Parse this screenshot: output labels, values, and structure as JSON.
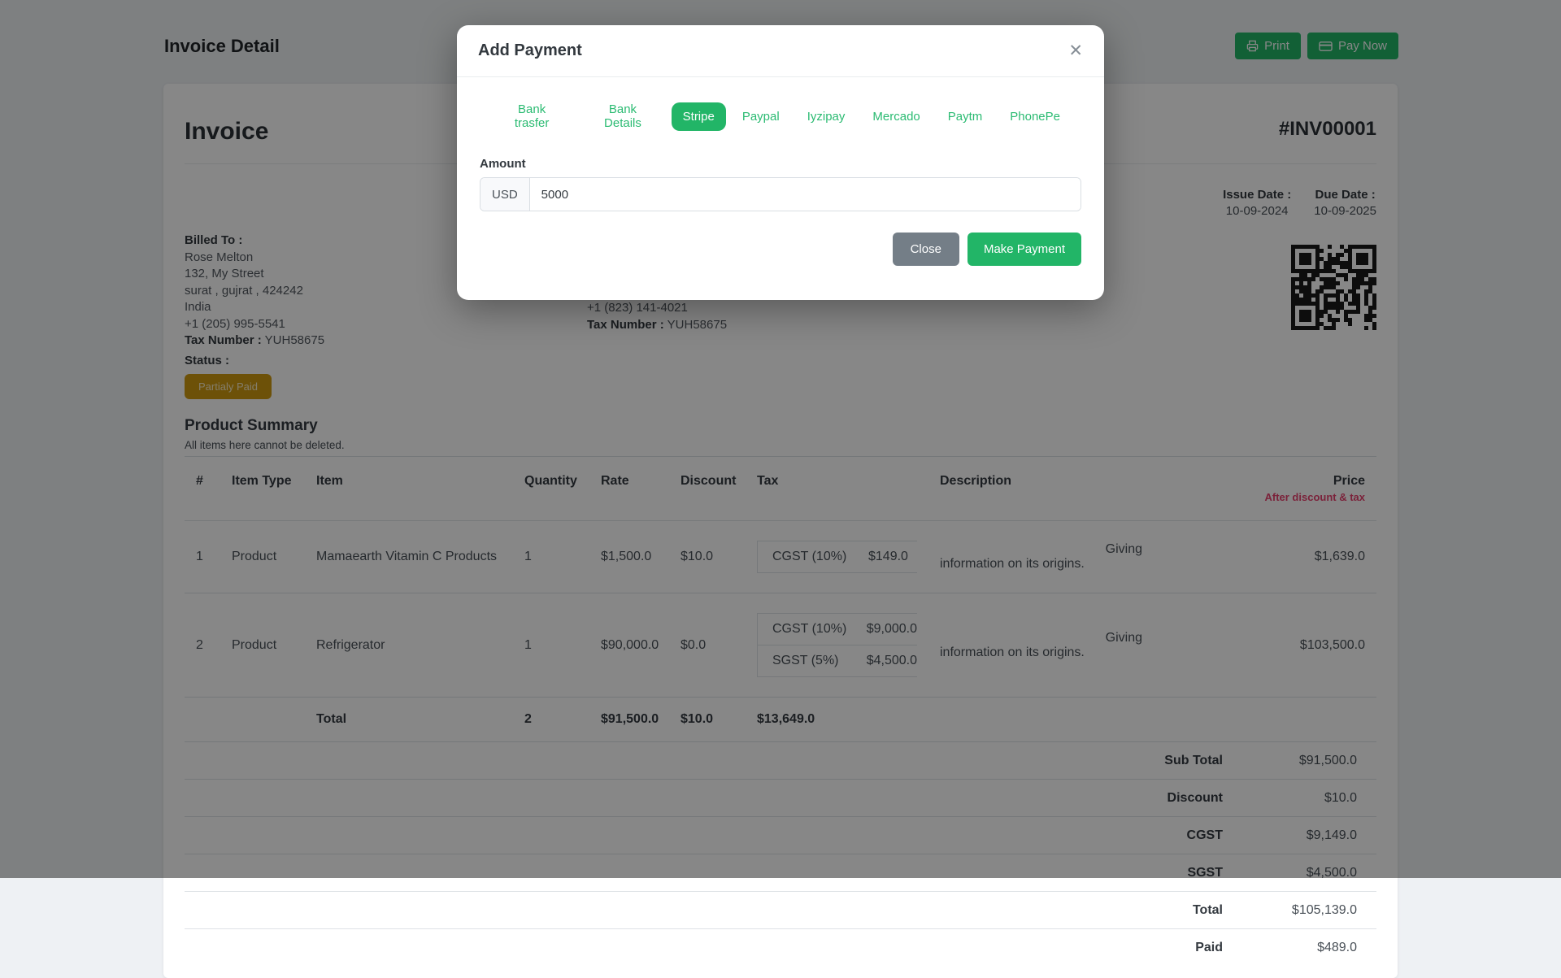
{
  "page": {
    "title": "Invoice Detail",
    "print_label": "Print",
    "pay_now_label": "Pay Now"
  },
  "invoice": {
    "heading": "Invoice",
    "number": "#INV00001",
    "billed_to": {
      "label": "Billed To :",
      "name": "Rose Melton",
      "street": "132, My Street",
      "city": "surat , gujrat , 424242",
      "country": "India",
      "phone": "+1 (205) 995-5541",
      "tax_label": "Tax Number :",
      "tax_value": "YUH58675"
    },
    "shipped_visible": {
      "phone": "+1 (823) 141-4021",
      "tax_label": "Tax Number :",
      "tax_value": "YUH58675"
    },
    "issue_date": {
      "label": "Issue Date :",
      "value": "10-09-2024"
    },
    "due_date": {
      "label": "Due Date :",
      "value": "10-09-2025"
    },
    "status_label": "Status :",
    "status_badge": "Partialy Paid"
  },
  "product_summary": {
    "title": "Product Summary",
    "note": "All items here cannot be deleted.",
    "columns": [
      "#",
      "Item Type",
      "Item",
      "Quantity",
      "Rate",
      "Discount",
      "Tax",
      "Description",
      "Price"
    ],
    "price_subheader": "After discount & tax",
    "rows": [
      {
        "num": "1",
        "item_type": "Product",
        "item": "Mamaearth Vitamin C Products",
        "quantity": "1",
        "rate": "$1,500.0",
        "discount": "$10.0",
        "taxes": [
          {
            "name": "CGST (10%)",
            "amount": "$149.0"
          }
        ],
        "desc_line1": "Giving",
        "desc_line2": "information on its origins.",
        "price": "$1,639.0"
      },
      {
        "num": "2",
        "item_type": "Product",
        "item": "Refrigerator",
        "quantity": "1",
        "rate": "$90,000.0",
        "discount": "$0.0",
        "taxes": [
          {
            "name": "CGST (10%)",
            "amount": "$9,000.0"
          },
          {
            "name": "SGST (5%)",
            "amount": "$4,500.0"
          }
        ],
        "desc_line1": "Giving",
        "desc_line2": "information on its origins.",
        "price": "$103,500.0"
      }
    ],
    "total_row": {
      "label": "Total",
      "quantity": "2",
      "rate": "$91,500.0",
      "discount": "$10.0",
      "tax": "$13,649.0"
    },
    "totals": [
      {
        "label": "Sub Total",
        "value": "$91,500.0"
      },
      {
        "label": "Discount",
        "value": "$10.0"
      },
      {
        "label": "CGST",
        "value": "$9,149.0"
      },
      {
        "label": "SGST",
        "value": "$4,500.0"
      },
      {
        "label": "Total",
        "value": "$105,139.0"
      },
      {
        "label": "Paid",
        "value": "$489.0"
      }
    ]
  },
  "modal": {
    "title": "Add Payment",
    "close_icon": "✕",
    "tabs": [
      "Bank trasfer",
      "Bank Details",
      "Stripe",
      "Paypal",
      "Iyzipay",
      "Mercado",
      "Paytm",
      "PhonePe"
    ],
    "amount_label": "Amount",
    "currency": "USD",
    "amount_value": "5000",
    "close_label": "Close",
    "make_payment_label": "Make Payment"
  },
  "colors": {
    "accent_green": "#22b567",
    "badge_amber": "#cf9a10",
    "price_sub_red": "#e8416f"
  }
}
